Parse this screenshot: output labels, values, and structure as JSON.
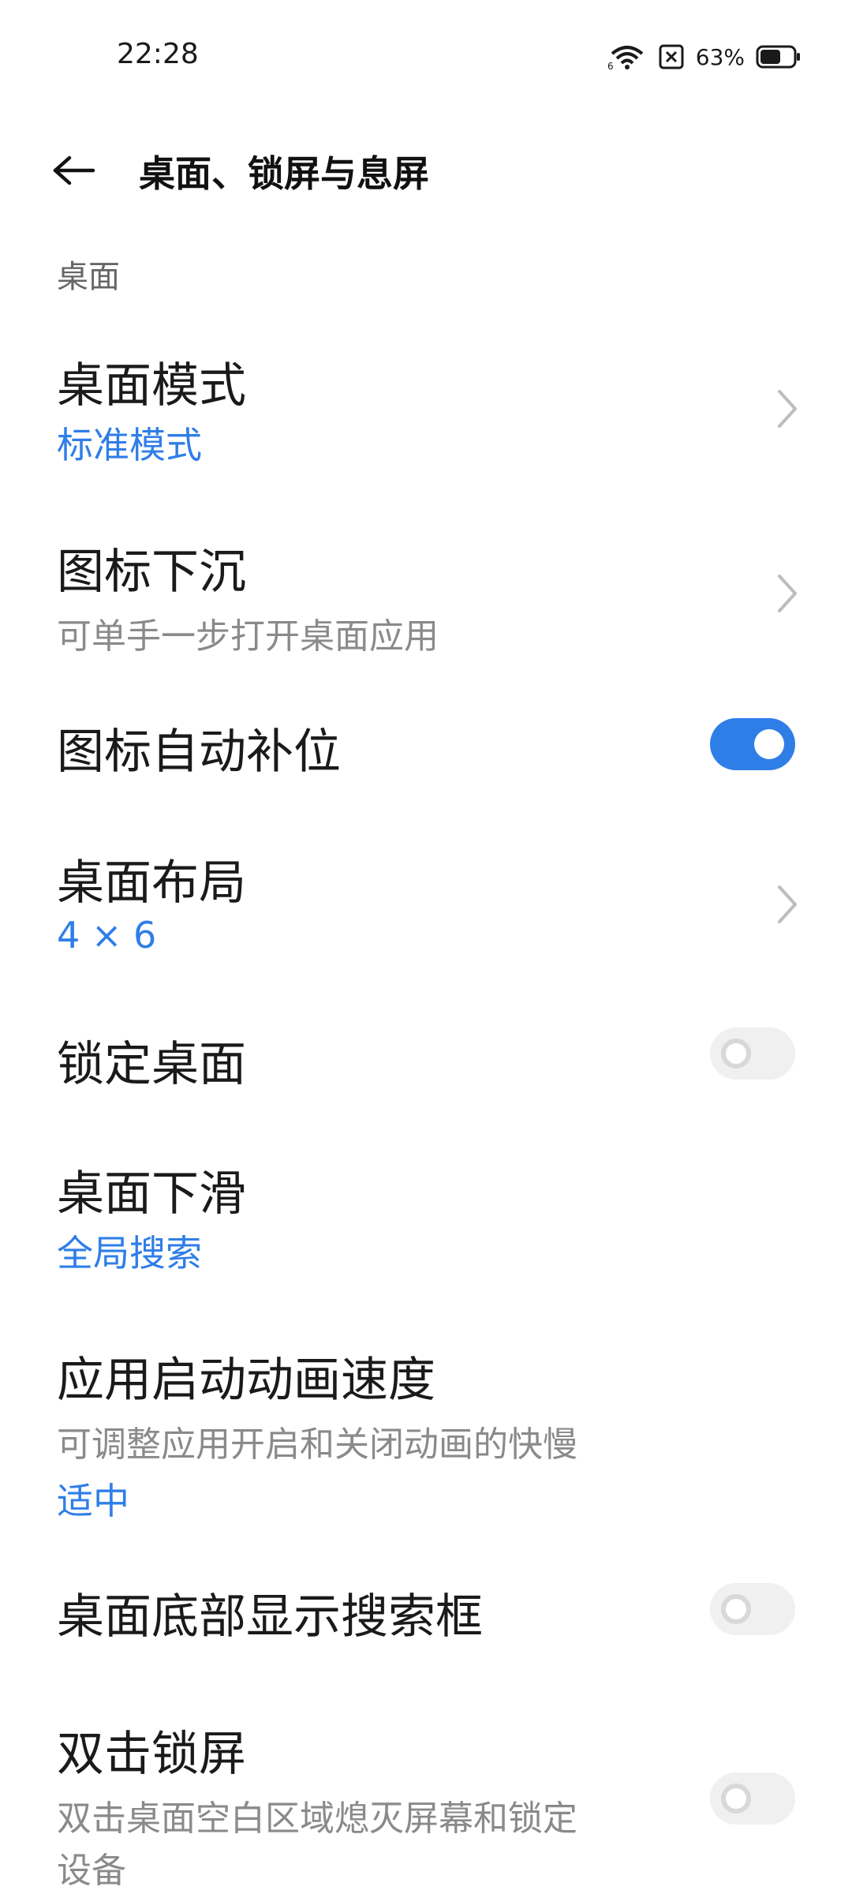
{
  "status_bar": {
    "time": "22:28",
    "battery_percent": "63%",
    "battery_level": 0.63,
    "icons": [
      "wifi-icon",
      "sim-disabled-icon",
      "battery-icon"
    ]
  },
  "header": {
    "title": "桌面、锁屏与息屏",
    "back_icon": "back-arrow-icon"
  },
  "section": {
    "title": "桌面"
  },
  "items": [
    {
      "title": "桌面模式",
      "value": "标准模式",
      "control": "chevron"
    },
    {
      "title": "图标下沉",
      "subtitle": "可单手一步打开桌面应用",
      "control": "chevron"
    },
    {
      "title": "图标自动补位",
      "control": "toggle",
      "checked": true
    },
    {
      "title": "桌面布局",
      "value": "4 × 6",
      "control": "chevron"
    },
    {
      "title": "锁定桌面",
      "control": "toggle",
      "checked": false
    },
    {
      "title": "桌面下滑",
      "value": "全局搜索",
      "control": "none"
    },
    {
      "title": "应用启动动画速度",
      "subtitle": "可调整应用开启和关闭动画的快慢",
      "value": "适中",
      "control": "none"
    },
    {
      "title": "桌面底部显示搜索框",
      "control": "toggle",
      "checked": false
    },
    {
      "title": "双击锁屏",
      "subtitle_lines": [
        "双击桌面空白区域熄灭屏幕和锁定",
        "设备"
      ],
      "control": "toggle",
      "checked": false
    }
  ],
  "colors": {
    "accent": "#2f7ee8",
    "toggle_off_track": "#f0f0f0",
    "secondary_text": "#8a8a8a",
    "section_text": "#666666"
  }
}
